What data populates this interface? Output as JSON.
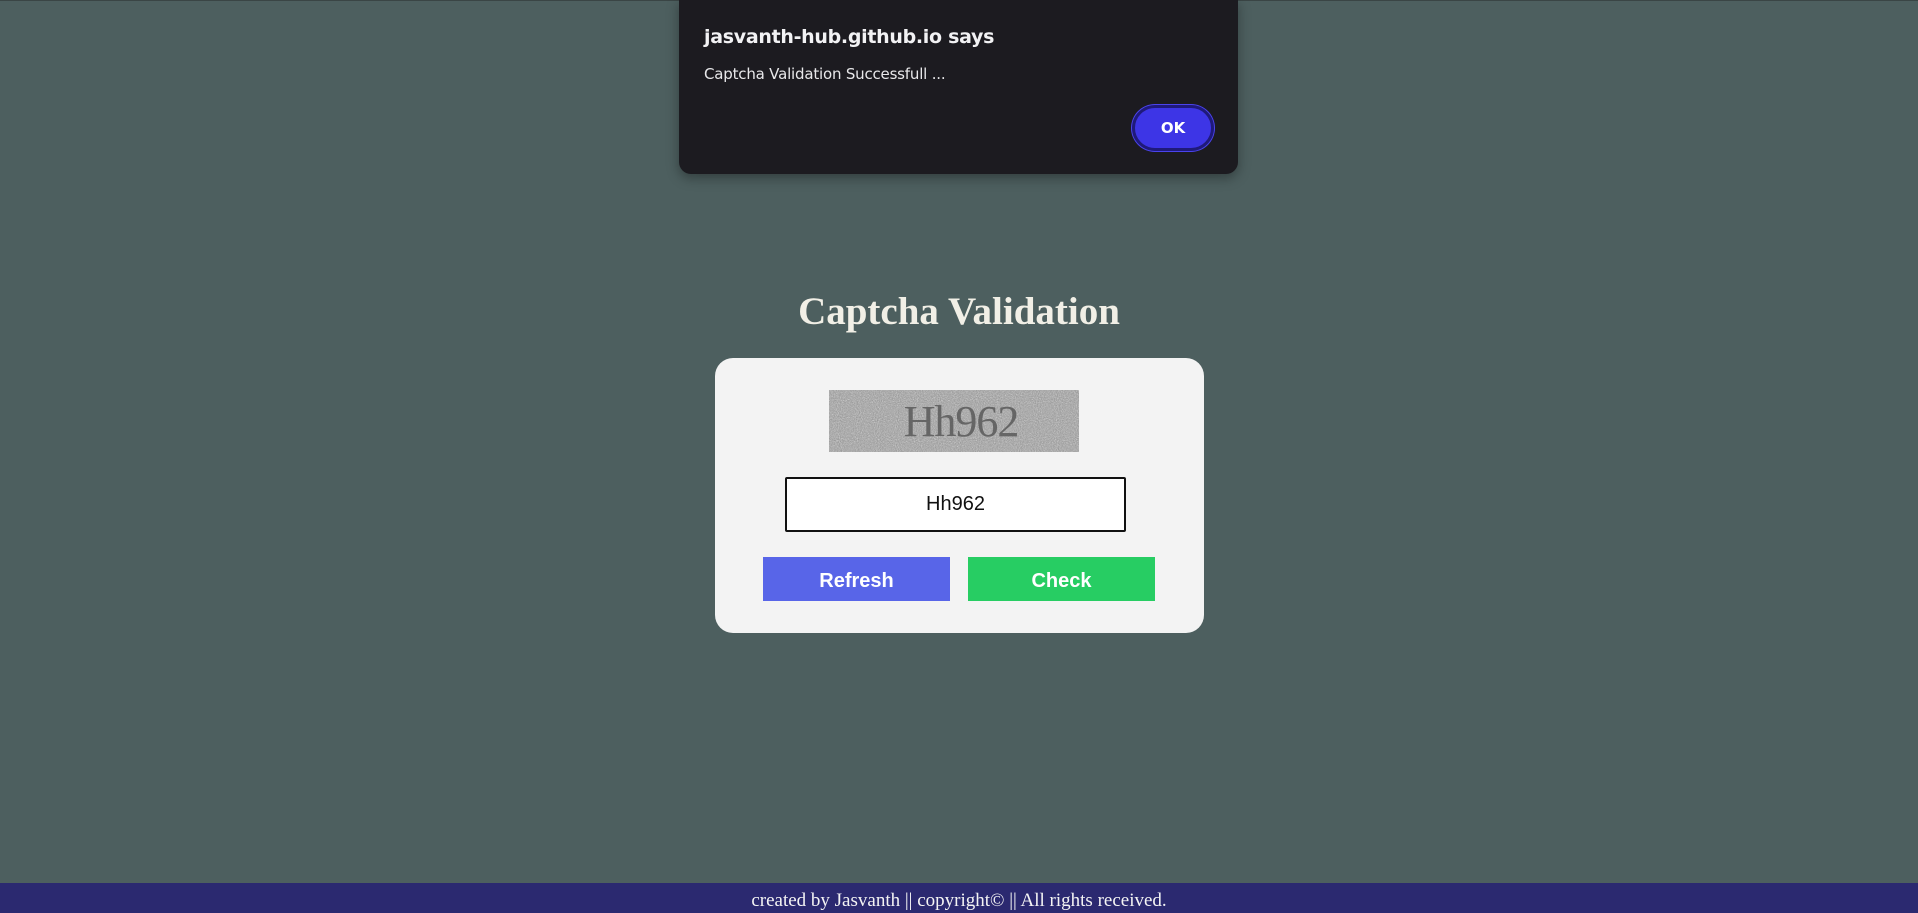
{
  "dialog": {
    "title": "jasvanth-hub.github.io says",
    "message": "Captcha Validation Successfull ...",
    "ok_label": "OK"
  },
  "page": {
    "title": "Captcha Validation"
  },
  "captcha": {
    "image_text": "Hh962",
    "input_value": "Hh962"
  },
  "buttons": {
    "refresh_label": "Refresh",
    "check_label": "Check"
  },
  "footer": {
    "text": "created by Jasvanth || copyright© || All rights received."
  },
  "colors": {
    "background": "#4d5f5f",
    "dialog_bg": "#1c1b20",
    "ok_button": "#3d35e6",
    "card_bg": "#f3f3f3",
    "refresh_button": "#5865e8",
    "check_button": "#27cd63",
    "footer_bg": "#2b2970"
  }
}
